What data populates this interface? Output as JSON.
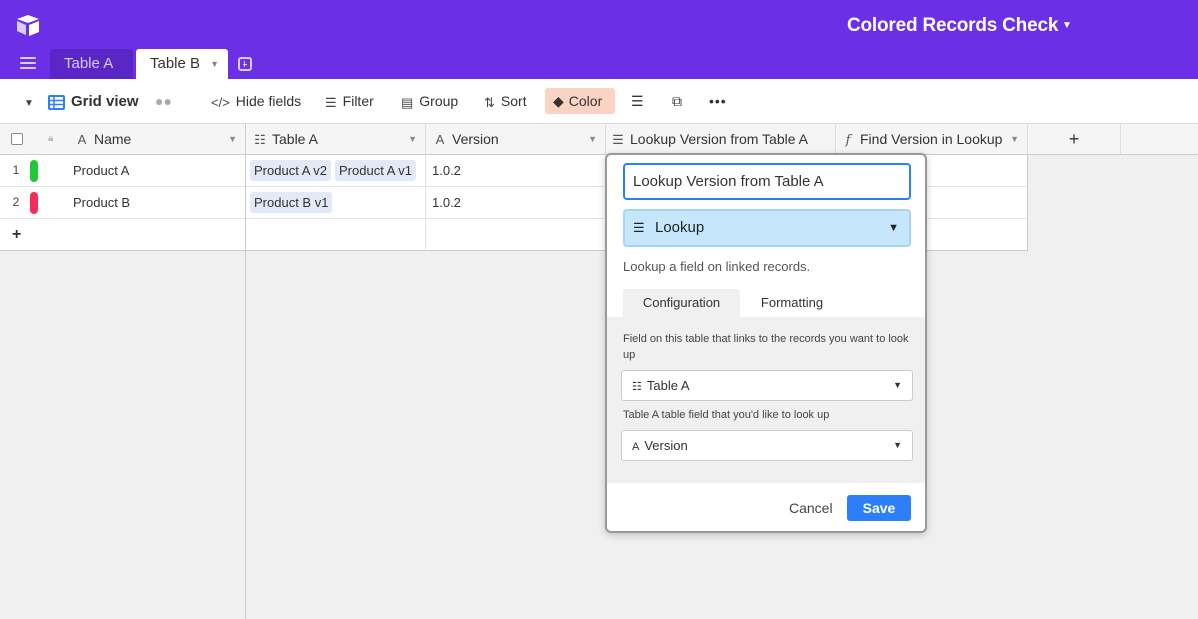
{
  "header": {
    "base_title": "Colored Records Check",
    "tabs": [
      {
        "label": "Table A"
      },
      {
        "label": "Table B"
      }
    ]
  },
  "toolbar": {
    "view_name": "Grid view",
    "hide_fields": "Hide fields",
    "filter": "Filter",
    "group": "Group",
    "sort": "Sort",
    "color": "Color"
  },
  "grid": {
    "columns": [
      {
        "label": "Name"
      },
      {
        "label": "Table A"
      },
      {
        "label": "Version"
      },
      {
        "label": "Lookup Version from Table A"
      },
      {
        "label": "Find Version in Lookup"
      }
    ],
    "add_column": "+",
    "add_row": "+",
    "rows": [
      {
        "num": "1",
        "color": "#20c933",
        "name": "Product A",
        "links": [
          "Product A v2",
          "Product A v1"
        ],
        "version": "1.0.2"
      },
      {
        "num": "2",
        "color": "#f82b60",
        "name": "Product B",
        "links": [
          "Product B v1"
        ],
        "version": "1.0.2"
      }
    ]
  },
  "popup": {
    "field_name": "Lookup Version from Table A",
    "field_type": "Lookup",
    "description": "Lookup a field on linked records.",
    "tabs": {
      "configuration": "Configuration",
      "formatting": "Formatting"
    },
    "link_label": "Field on this table that links to the records you want to look up",
    "link_value": "Table A",
    "lookup_label": "Table A table field that you'd like to look up",
    "lookup_value": "Version",
    "cancel": "Cancel",
    "save": "Save"
  },
  "colors": {
    "topbar": "#6b2fe6",
    "accent_blue": "#2d7ff9",
    "color_button_bg": "#fbd3c4"
  }
}
